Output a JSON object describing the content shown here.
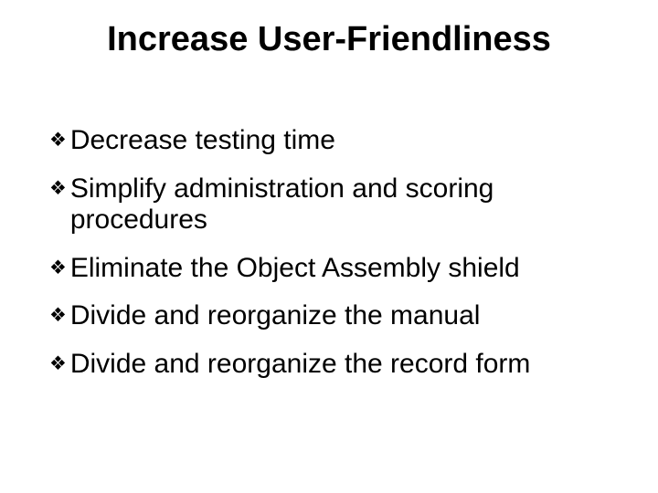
{
  "title": "Increase User-Friendliness",
  "bullets": [
    "Decrease testing time",
    "Simplify administration and scoring procedures",
    "Eliminate the Object Assembly shield",
    "Divide and reorganize the manual",
    "Divide and reorganize the record form"
  ]
}
